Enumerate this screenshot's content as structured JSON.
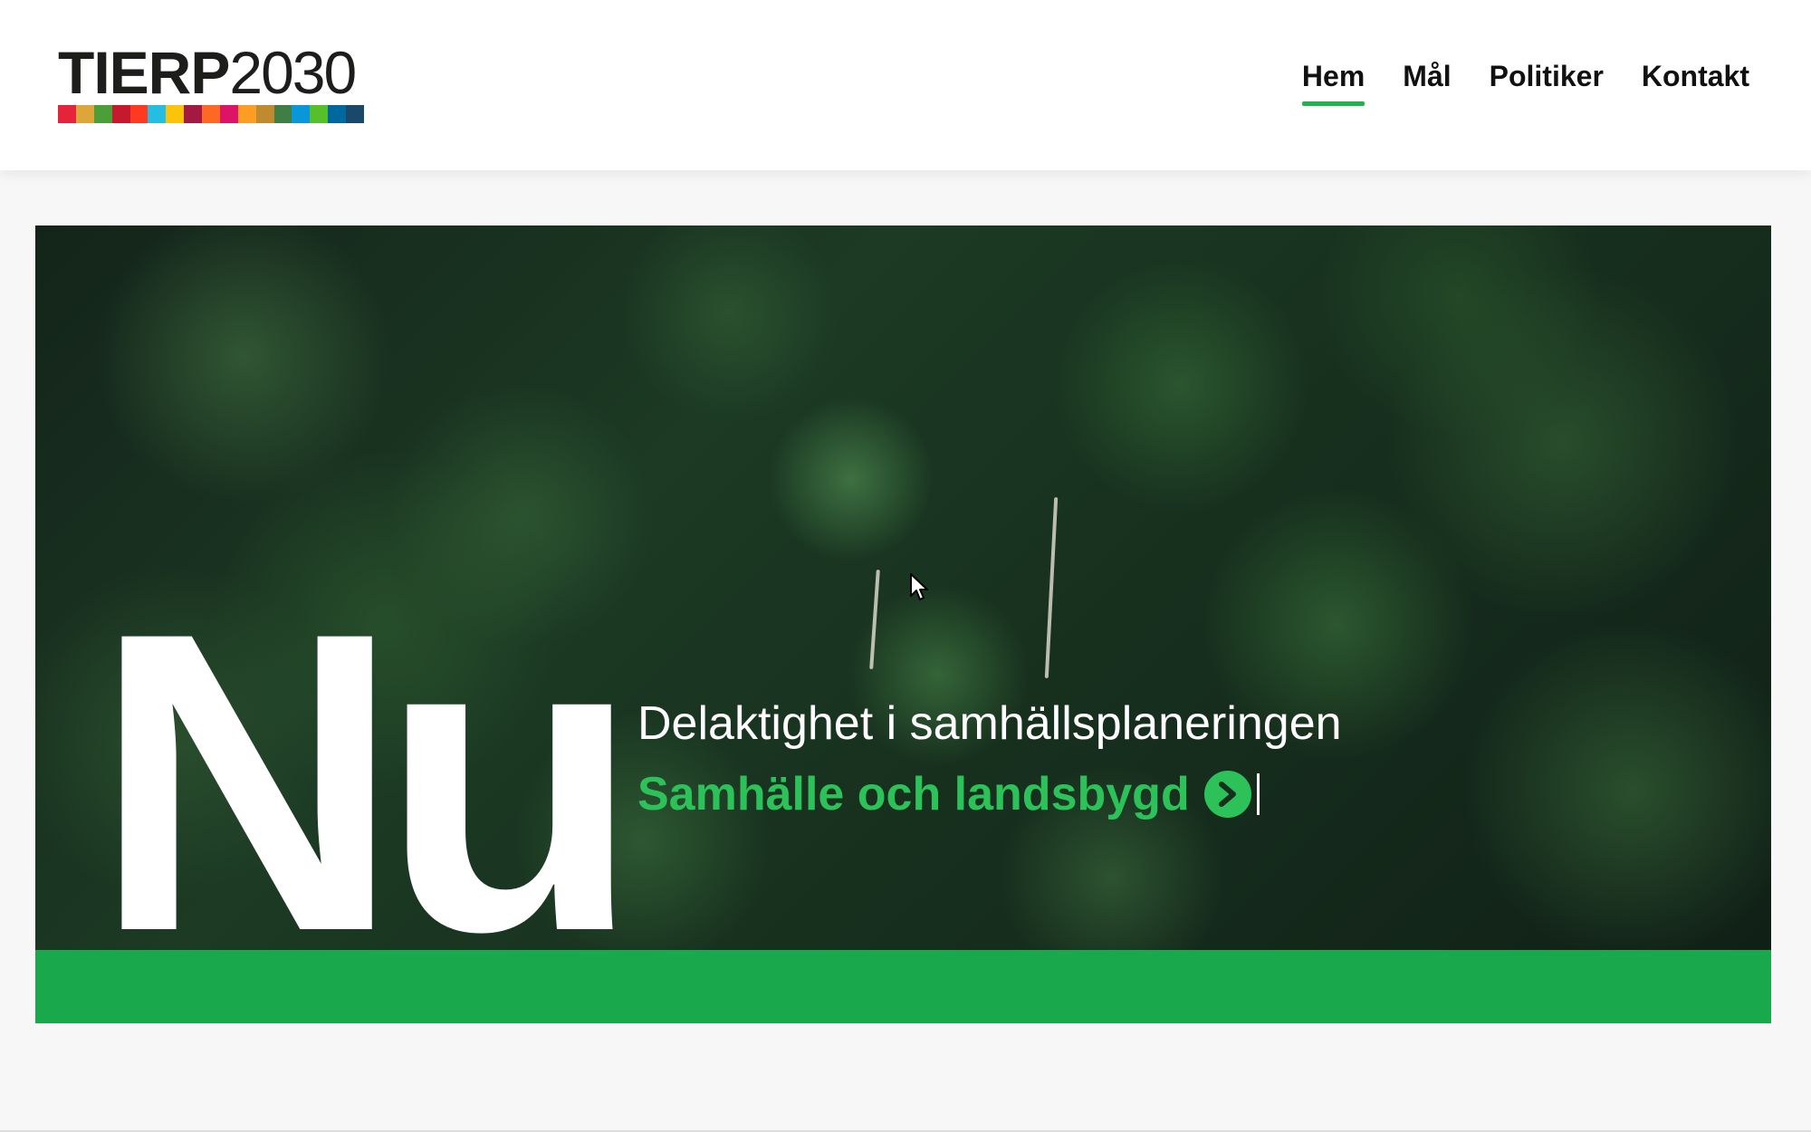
{
  "header": {
    "logo": {
      "bold_text": "TIERP",
      "light_text": "2030",
      "bar_colors": [
        "#e5243b",
        "#dda63a",
        "#4c9f38",
        "#c5192d",
        "#ff3a21",
        "#26bde2",
        "#fcc30b",
        "#a21942",
        "#fd6925",
        "#dd1367",
        "#fd9d24",
        "#bf8b2e",
        "#3f7e44",
        "#0a97d9",
        "#56c02b",
        "#00689d",
        "#19486a"
      ]
    },
    "nav": {
      "items": [
        {
          "label": "Hem",
          "active": true
        },
        {
          "label": "Mål",
          "active": false
        },
        {
          "label": "Politiker",
          "active": false
        },
        {
          "label": "Kontakt",
          "active": false
        }
      ]
    }
  },
  "hero": {
    "big_word": "Nu",
    "subtitle": "Delaktighet i samhällsplaneringen",
    "link_label": "Samhälle och landsbygd",
    "link_icon": "chevron-right-circle-icon",
    "background": "forest-aerial-photo"
  },
  "colors": {
    "accent_green": "#1aa84d",
    "link_green": "#2dc15a",
    "nav_text": "#111111"
  }
}
